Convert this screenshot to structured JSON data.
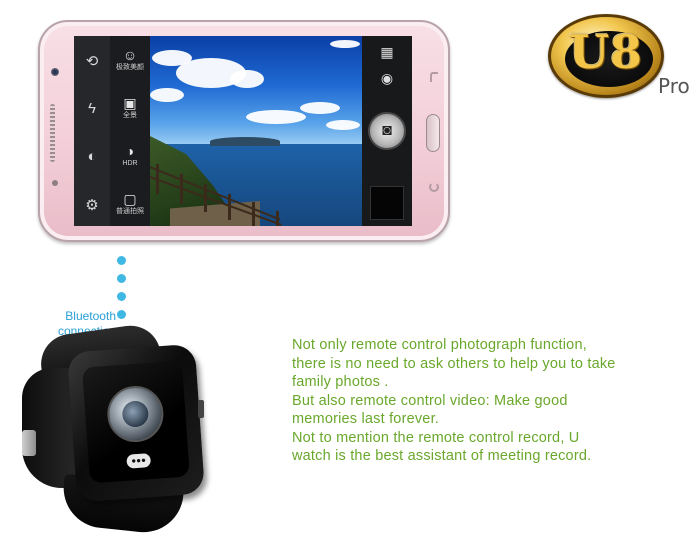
{
  "phone": {
    "camera_menu": {
      "items": [
        {
          "label": "极致美颜",
          "icon": "beauty-icon"
        },
        {
          "label": "全景",
          "icon": "panorama-icon"
        },
        {
          "label": "HDR",
          "icon": "hdr-icon"
        },
        {
          "label": "普通拍照",
          "icon": "normal-photo-icon"
        }
      ]
    }
  },
  "logo": {
    "pro": "Pro",
    "text": "U8"
  },
  "connection": {
    "line1": "Bluetooth",
    "line2": "connection"
  },
  "description": {
    "lines": [
      "Not only remote control photograph function,",
      "there is no need to ask others to help you to take",
      "family photos .",
      "But also remote control video: Make good",
      "memories last forever.",
      "Not to mention the remote control record, U",
      "watch is the best assistant of meeting record."
    ]
  },
  "colors": {
    "text_green": "#6aa82c",
    "bluetooth_blue": "#2a9fd6",
    "dot_blue": "#3fb8e4",
    "logo_gold": "#f3c64a"
  }
}
